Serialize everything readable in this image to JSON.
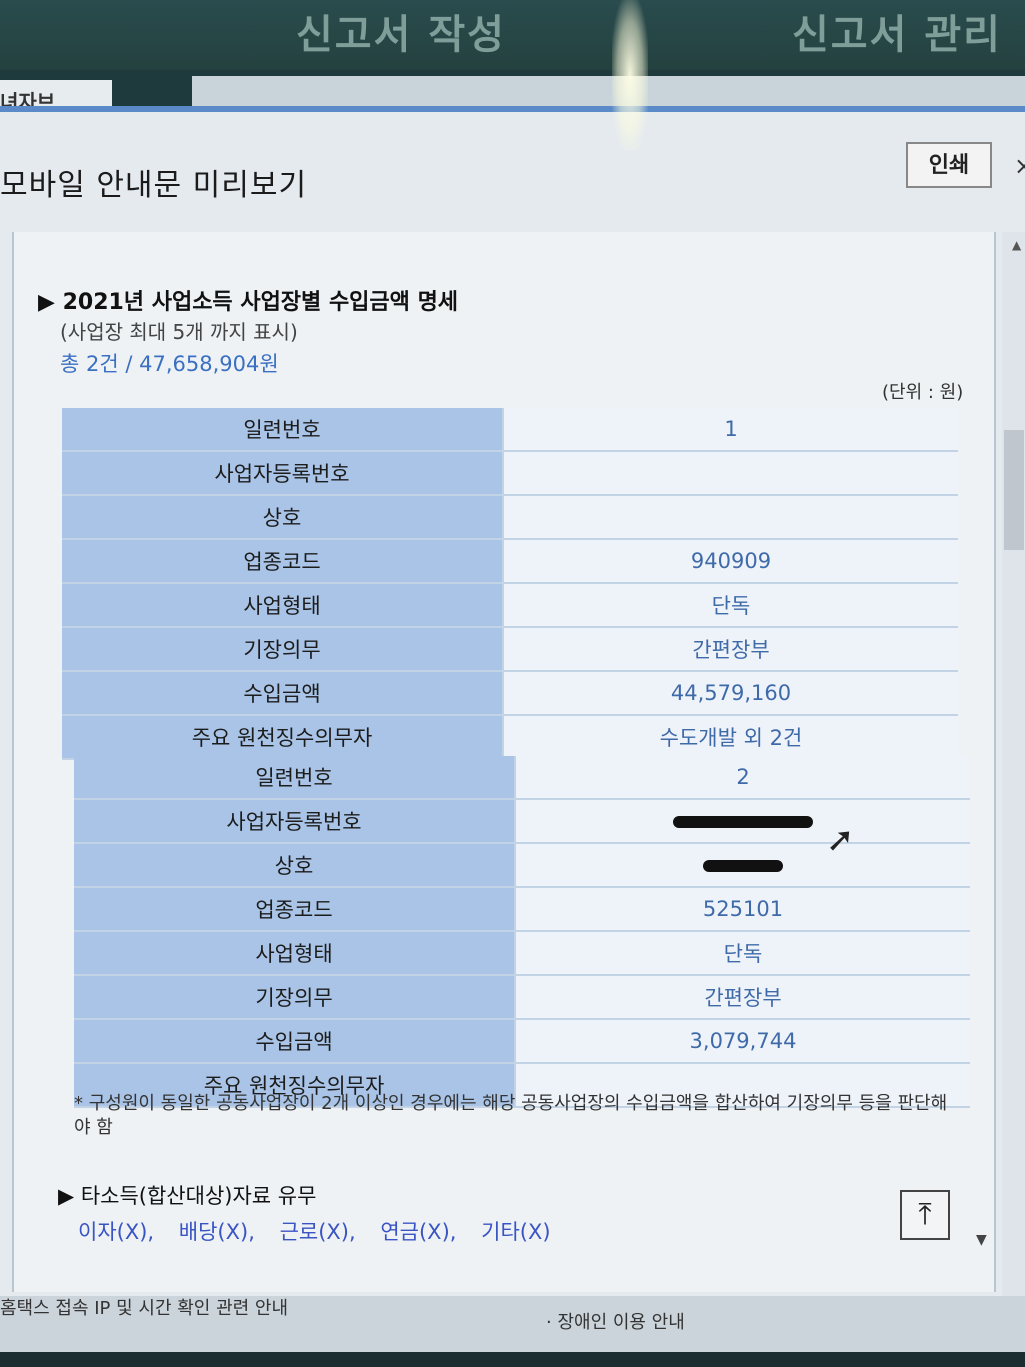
{
  "background": {
    "tabs": [
      "신고서 작성",
      "신고서 관리"
    ],
    "sub_tab": "녀자브",
    "bottom_links": [
      "홈택스 접속 IP 및 시간 확인 관련 안내",
      "· 장애인 이용 안내"
    ]
  },
  "modal": {
    "title": "모바일 안내문 미리보기",
    "print_label": "인쇄",
    "close_label": "×"
  },
  "section": {
    "title": "▶ 2021년 사업소득 사업장별 수입금액 명세",
    "subtitle": "(사업장 최대 5개 까지 표시)",
    "total": "총 2건 / 47,658,904원",
    "unit": "(단위 : 원)"
  },
  "businesses": [
    {
      "rows": [
        {
          "label": "일련번호",
          "value": "1"
        },
        {
          "label": "사업자등록번호",
          "value": ""
        },
        {
          "label": "상호",
          "value": ""
        },
        {
          "label": "업종코드",
          "value": "940909"
        },
        {
          "label": "사업형태",
          "value": "단독"
        },
        {
          "label": "기장의무",
          "value": "간편장부"
        },
        {
          "label": "수입금액",
          "value": "44,579,160"
        },
        {
          "label": "주요 원천징수의무자",
          "value": "수도개발 외 2건"
        }
      ]
    },
    {
      "rows": [
        {
          "label": "일련번호",
          "value": "2"
        },
        {
          "label": "사업자등록번호",
          "value": ""
        },
        {
          "label": "상호",
          "value": ""
        },
        {
          "label": "업종코드",
          "value": "525101"
        },
        {
          "label": "사업형태",
          "value": "단독"
        },
        {
          "label": "기장의무",
          "value": "간편장부"
        },
        {
          "label": "수입금액",
          "value": "3,079,744"
        },
        {
          "label": "주요 원천징수의무자",
          "value": ""
        }
      ]
    }
  ],
  "note": "* 구성원이 동일한 공동사업장이 2개 이상인 경우에는 해당 공동사업장의 수입금액을 합산하여 기장의무 등을 판단해야 함",
  "other_income": {
    "title": "▶ 타소득(합산대상)자료 유무",
    "items": [
      "이자(X),",
      "배당(X),",
      "근로(X),",
      "연금(X),",
      "기타(X)"
    ]
  },
  "top_button_label": "⤒"
}
